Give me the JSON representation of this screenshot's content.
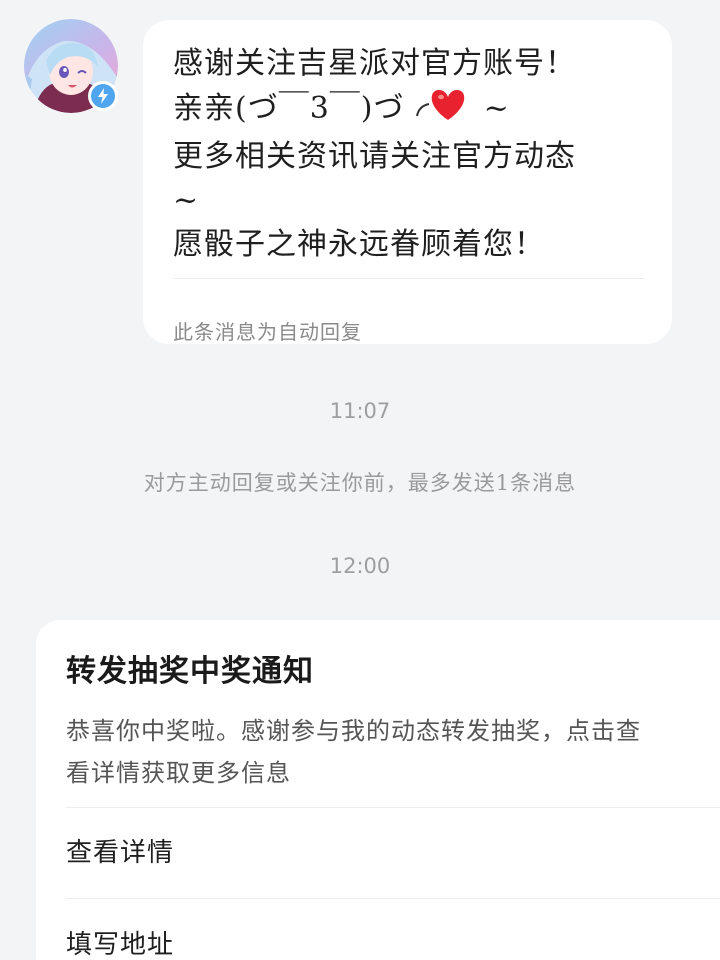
{
  "avatar": {
    "icon": "anime-character-avatar",
    "badge_icon": "verified-lightning-icon",
    "badge_color": "#4fa6ee"
  },
  "message": {
    "lines": [
      "感谢关注吉星派对官方账号！",
      "亲亲(づ￣3￣)づ",
      "~",
      "更多相关资讯请关注官方动态",
      "~",
      "愿骰子之神永远眷顾着您！"
    ],
    "heart_icon": "red-heart-emoji",
    "footer": "此条消息为自动回复"
  },
  "timestamps": [
    "11:07",
    "12:00"
  ],
  "notice": "对方主动回复或关注你前，最多发送1条消息",
  "prize_card": {
    "title": "转发抽奖中奖通知",
    "description_line1": "恭喜你中奖啦。感谢参与我的动态转发抽奖，点击查",
    "description_line2": "看详情获取更多信息",
    "actions": [
      "查看详情",
      "填写地址"
    ]
  }
}
